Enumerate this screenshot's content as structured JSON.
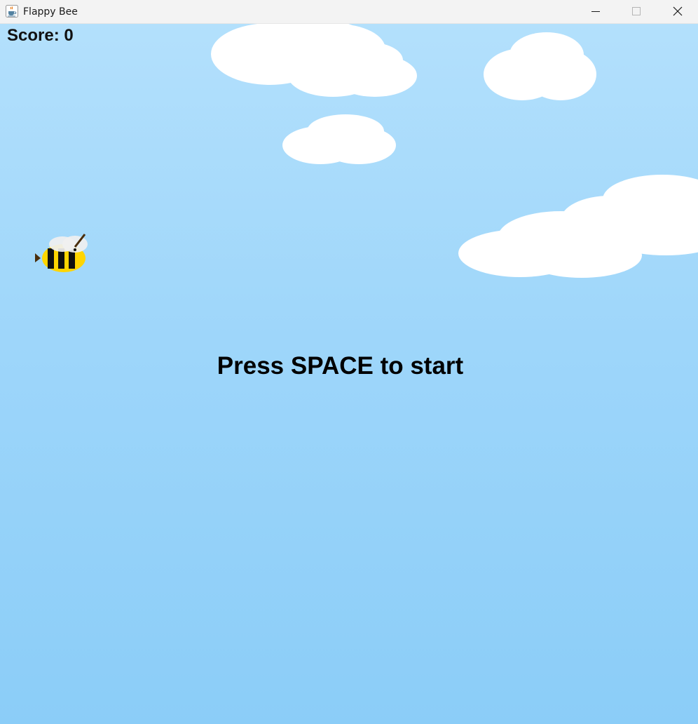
{
  "window": {
    "title": "Flappy Bee",
    "app_icon": "java-cup-icon",
    "controls": {
      "minimize_icon": "minimize-icon",
      "maximize_icon": "maximize-icon",
      "close_icon": "close-icon"
    }
  },
  "game": {
    "score_text": "Score: 0",
    "start_prompt": "Press SPACE to start",
    "player_icon": "bee-icon",
    "scenery_icons": [
      "cloud-icon"
    ]
  },
  "colors": {
    "sky_top": "#b3e0fc",
    "sky_bottom": "#8bcdf8",
    "cloud": "#ffffff",
    "bee_body": "#ffd500",
    "bee_stripes": "#111111",
    "bee_wings": "#f0f0f0",
    "bee_stinger": "#4a2e0c",
    "titlebar": "#f3f3f3",
    "text": "#000000"
  }
}
